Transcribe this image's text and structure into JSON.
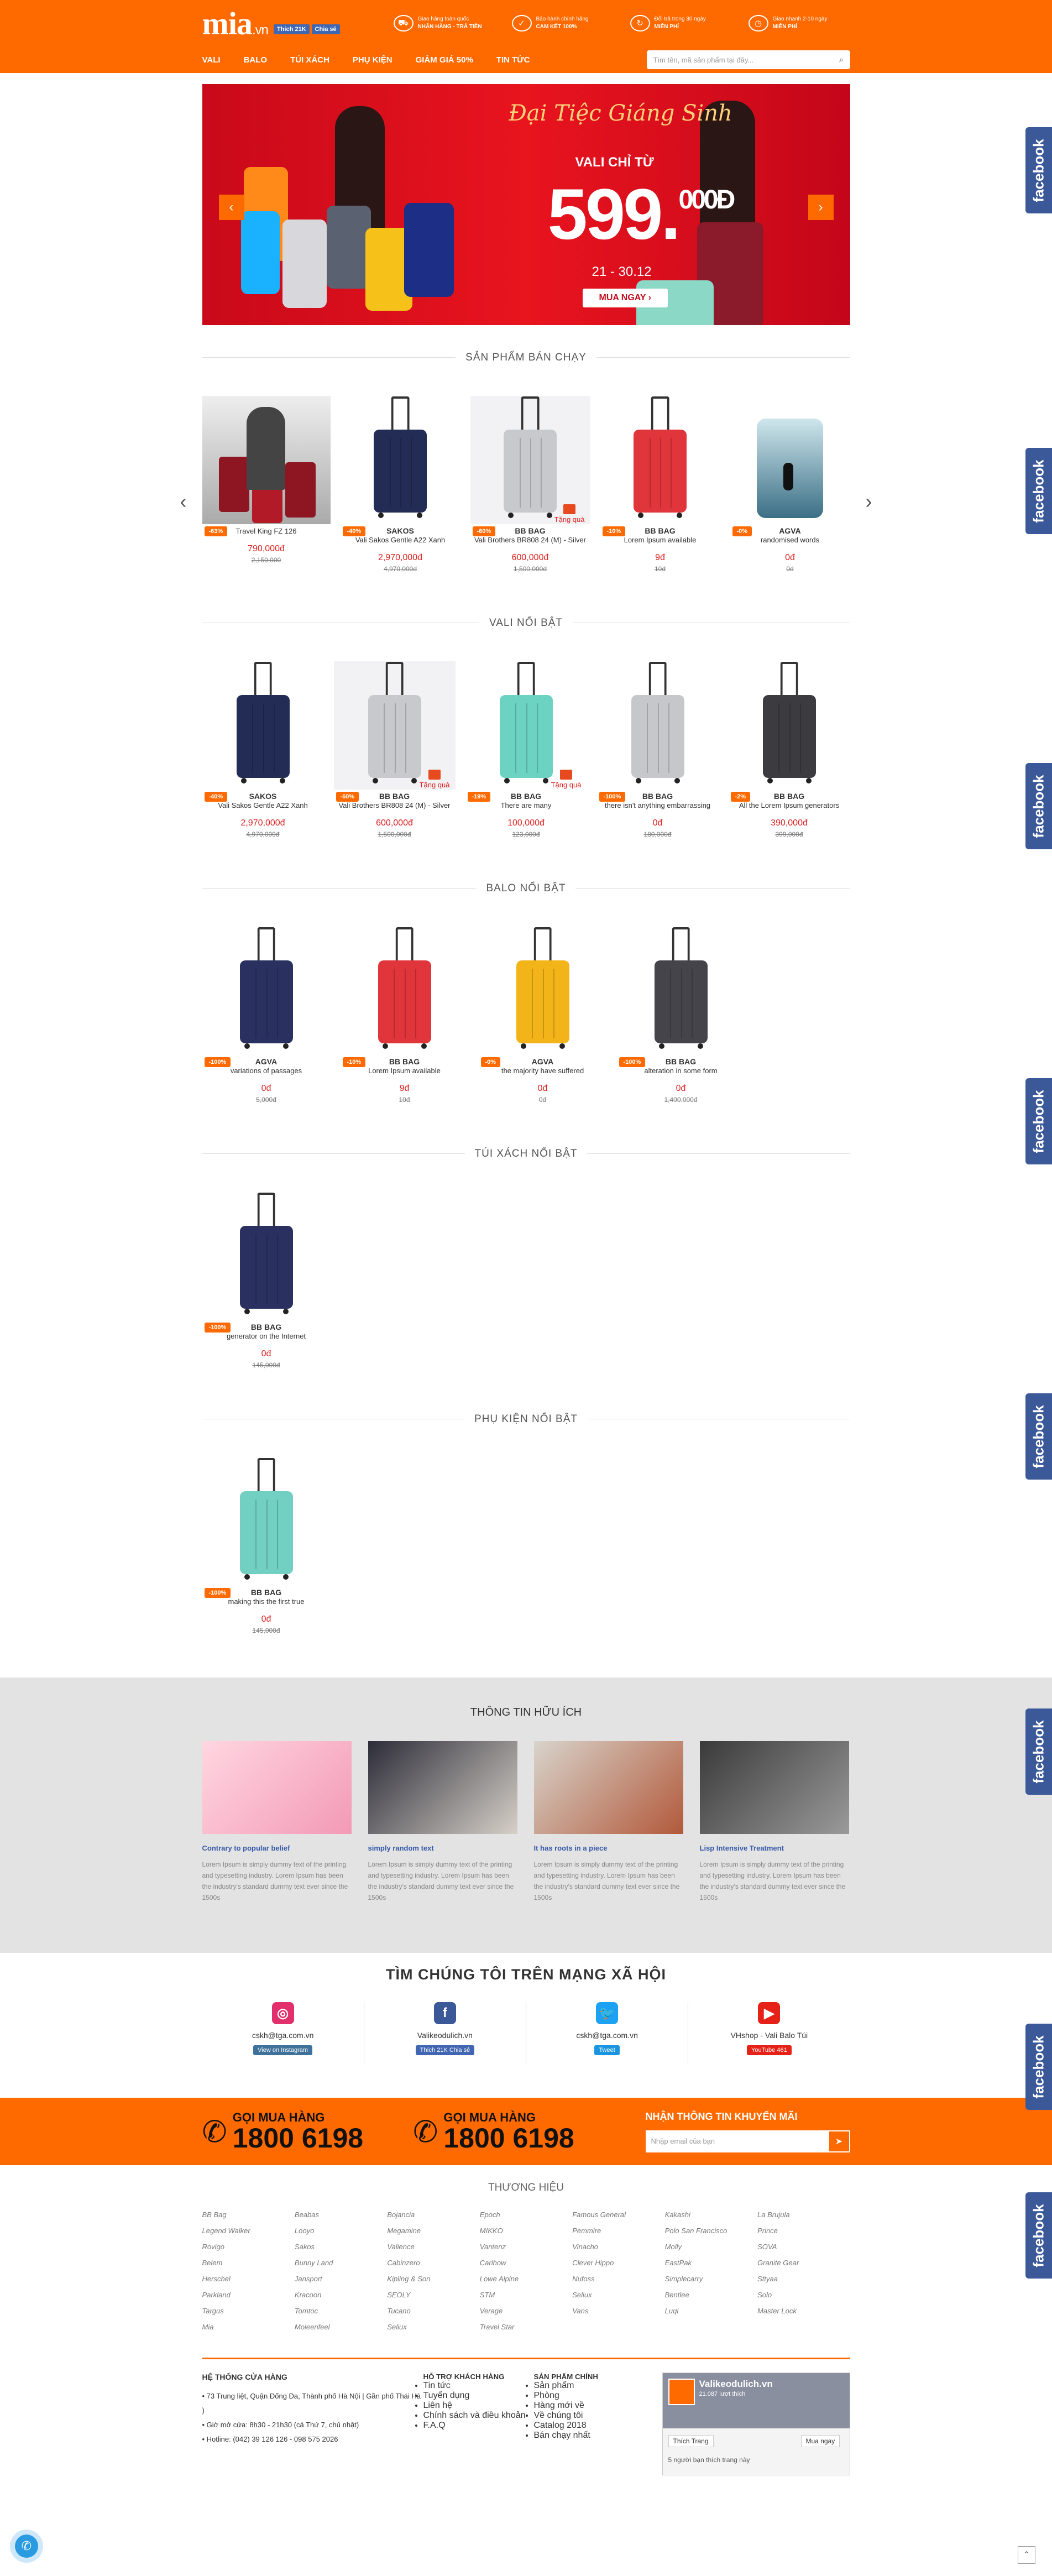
{
  "header": {
    "logo": "mia",
    "logo_suffix": ".vn",
    "fb_like": "Thích 21K",
    "fb_share": "Chia sẻ",
    "promos": [
      {
        "icon": "truck-icon",
        "line1": "Giao hàng toàn quốc",
        "line2": "NHẬN HÀNG - TRẢ TIỀN"
      },
      {
        "icon": "shield-icon",
        "line1": "Bảo hành chính hãng",
        "line2": "CAM KẾT 100%"
      },
      {
        "icon": "refresh-icon",
        "line1": "Đổi trả trong 30 ngày",
        "line2": "MIỄN PHÍ"
      },
      {
        "icon": "clock-icon",
        "line1": "Giao nhanh 2-10 ngày",
        "line2": "MIỄN PHÍ"
      }
    ],
    "nav": [
      "VALI",
      "BALO",
      "TÚI XÁCH",
      "PHỤ KIỆN",
      "GIẢM GIÁ 50%",
      "TIN TỨC"
    ],
    "search_placeholder": "Tìm tên, mã sản phẩm tại đây..."
  },
  "banner": {
    "title": "Đại Tiệc Giáng Sinh",
    "subtitle": "VALI CHỈ TỪ",
    "price": "599.",
    "price_sup": "000Đ",
    "date": "21 - 30.12",
    "cta": "MUA NGAY ›"
  },
  "sections": {
    "bestseller": {
      "title": "SẢN PHẨM BÁN CHẠY",
      "items": [
        {
          "disc": "-63%",
          "brand": "",
          "name": "Travel King FZ 126",
          "price": "790,000đ",
          "old": "2,150,000"
        },
        {
          "disc": "-40%",
          "brand": "SAKOS",
          "name": "Vali Sakos Gentle A22 Xanh",
          "price": "2,970,000đ",
          "old": "4,970,000đ"
        },
        {
          "disc": "-60%",
          "brand": "BB BAG",
          "name": "Vali Brothers BR808 24 (M) - Silver",
          "price": "600,000đ",
          "old": "1,500,000đ",
          "gift": "Tặng quà"
        },
        {
          "disc": "-10%",
          "brand": "BB BAG",
          "name": "Lorem Ipsum available",
          "price": "9đ",
          "old": "10đ"
        },
        {
          "disc": "-0%",
          "brand": "AGVA",
          "name": "randomised words",
          "price": "0đ",
          "old": "0đ"
        }
      ]
    },
    "vali": {
      "title": "VALI NỔI BẬT",
      "items": [
        {
          "disc": "-40%",
          "brand": "SAKOS",
          "name": "Vali Sakos Gentle A22 Xanh",
          "price": "2,970,000đ",
          "old": "4,970,000đ"
        },
        {
          "disc": "-60%",
          "brand": "BB BAG",
          "name": "Vali Brothers BR808 24 (M) - Silver",
          "price": "600,000đ",
          "old": "1,500,000đ",
          "gift": "Tặng quà"
        },
        {
          "disc": "-19%",
          "brand": "BB BAG",
          "name": "There are many",
          "price": "100,000đ",
          "old": "123,000đ",
          "gift": "Tặng quà"
        },
        {
          "disc": "-100%",
          "brand": "BB BAG",
          "name": "there isn't anything embarrassing",
          "price": "0đ",
          "old": "180,000đ"
        },
        {
          "disc": "-2%",
          "brand": "BB BAG",
          "name": "All the Lorem Ipsum generators",
          "price": "390,000đ",
          "old": "399,000đ"
        }
      ]
    },
    "balo": {
      "title": "BALO NỔI BẬT",
      "items": [
        {
          "disc": "-100%",
          "brand": "AGVA",
          "name": "variations of passages",
          "price": "0đ",
          "old": "5,000đ"
        },
        {
          "disc": "-10%",
          "brand": "BB BAG",
          "name": "Lorem Ipsum available",
          "price": "9đ",
          "old": "10đ"
        },
        {
          "disc": "-0%",
          "brand": "AGVA",
          "name": "the majority have suffered",
          "price": "0đ",
          "old": "0đ"
        },
        {
          "disc": "-100%",
          "brand": "BB BAG",
          "name": "alteration in some form",
          "price": "0đ",
          "old": "1,400,000đ"
        }
      ]
    },
    "tuixach": {
      "title": "TÚI XÁCH NỔI BẬT",
      "items": [
        {
          "disc": "-100%",
          "brand": "BB BAG",
          "name": "generator on the Internet",
          "price": "0đ",
          "old": "145,000đ"
        }
      ]
    },
    "phukien": {
      "title": "PHỤ KIỆN NỔI BẬT",
      "items": [
        {
          "disc": "-100%",
          "brand": "BB BAG",
          "name": "making this the first true",
          "price": "0đ",
          "old": "145,000đ"
        }
      ]
    }
  },
  "info": {
    "title": "THÔNG TIN HỮU ÍCH",
    "articles": [
      {
        "title": "Contrary to popular belief",
        "body": "Lorem Ipsum is simply dummy text of the printing and typesetting industry. Lorem Ipsum has been the industry's standard dummy text ever since the 1500s"
      },
      {
        "title": "simply random text",
        "body": "Lorem Ipsum is simply dummy text of the printing and typesetting industry. Lorem Ipsum has been the industry's standard dummy text ever since the 1500s"
      },
      {
        "title": "It has roots in a piece",
        "body": "Lorem Ipsum is simply dummy text of the printing and typesetting industry. Lorem Ipsum has been the industry's standard dummy text ever since the 1500s"
      },
      {
        "title": "Lisp Intensive Treatment",
        "body": "Lorem Ipsum is simply dummy text of the printing and typesetting industry. Lorem Ipsum has been the industry's standard dummy text ever since the 1500s"
      }
    ]
  },
  "social": {
    "title": "TÌM CHÚNG TÔI TRÊN MẠNG XÃ HỘI",
    "items": [
      {
        "icon": "instagram-icon",
        "color": "#e1306c",
        "handle": "cskh@tga.com.vn",
        "button": "View on Instagram",
        "btn_color": "#3f729b"
      },
      {
        "icon": "facebook-icon",
        "color": "#3b5998",
        "handle": "Valikeodulich.vn",
        "button": "Thích 21K  Chia sẻ",
        "btn_color": "#4267b2"
      },
      {
        "icon": "twitter-icon",
        "color": "#1da1f2",
        "handle": "cskh@tga.com.vn",
        "button": "Tweet",
        "btn_color": "#1b95e0"
      },
      {
        "icon": "youtube-icon",
        "color": "#e62117",
        "handle": "VHshop - Vali Balo Túi",
        "button": "YouTube 461",
        "btn_color": "#e62117"
      }
    ]
  },
  "hotline": {
    "label": "GỌI MUA HÀNG",
    "number": "1800 6198",
    "newsletter_label": "NHẬN THÔNG TIN KHUYẾN MÃI",
    "newsletter_placeholder": "Nhập email của bạn"
  },
  "brands": {
    "title": "THƯƠNG HIỆU",
    "list": [
      "BB Bag",
      "Beabas",
      "Bojancia",
      "Epoch",
      "Famous General",
      "Kakashi",
      "La Brujula",
      "Legend Walker",
      "Looyo",
      "Megamine",
      "MIKKO",
      "Pemmire",
      "Polo San Francisco",
      "Prince",
      "Rovigo",
      "Sakos",
      "Valience",
      "Vantenz",
      "Vinacho",
      "Molly",
      "SOVA",
      "Belem",
      "Bunny Land",
      "Cabinzero",
      "Carlhow",
      "Clever Hippo",
      "EastPak",
      "Granite Gear",
      "Herschel",
      "Jansport",
      "Kipling & Son",
      "Lowe Alpine",
      "Nufoss",
      "Simplecarry",
      "Sttyaa",
      "Parkland",
      "Kracoon",
      "SEOLY",
      "STM",
      "Seliux",
      "Bentlee",
      "Solo",
      "Targus",
      "Tomtoc",
      "Tucano",
      "Verage",
      "Vans",
      "Luqi",
      "Master Lock",
      "Mia",
      "Moleenfeel",
      "Seliux",
      "Travel Star"
    ]
  },
  "footer": {
    "col1_title": "HỆ THỐNG CỬA HÀNG",
    "col1": [
      "• 73 Trung liệt, Quận Đống Đa, Thành phố Hà Nội | Gần phố Thái Hà )",
      "• Giờ mở cửa: 8h30 - 21h30 (cả Thứ 7, chủ nhật)",
      "• Hotline: (042) 39 126 126 - 098 575 2026"
    ],
    "col2_title": "HỖ TRỢ KHÁCH HÀNG",
    "col2": [
      "Tin tức",
      "Tuyển dụng",
      "Liên hệ",
      "Chính sách và điều khoản",
      "F.A.Q"
    ],
    "col3_title": "SẢN PHẨM CHÍNH",
    "col3": [
      "Sản phẩm",
      "Phòng",
      "Hàng mới về",
      "Về chúng tôi",
      "Catalog 2018",
      "Bán chạy nhất"
    ],
    "fb_name": "Valikeodulich.vn",
    "fb_likes": "21.087 lượt thích",
    "fb_like_btn": "Thích Trang",
    "fb_buy_btn": "Mua ngay",
    "fb_friends": "5 người bạn thích trang này"
  },
  "side_tab": "facebook"
}
